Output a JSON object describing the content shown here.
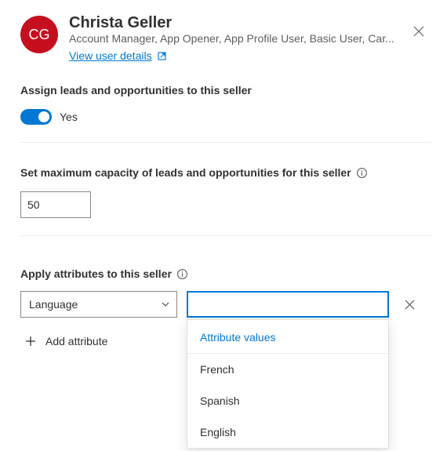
{
  "user": {
    "initials": "CG",
    "name": "Christa Geller",
    "roles": "Account Manager, App Opener, App Profile User, Basic User, Car...",
    "view_link": "View user details"
  },
  "assign": {
    "label": "Assign leads and opportunities to this seller",
    "toggle_text": "Yes"
  },
  "capacity": {
    "label": "Set maximum capacity of leads and opportunities for this seller",
    "value": "50"
  },
  "attributes": {
    "label": "Apply attributes to this seller",
    "selected_type": "Language",
    "value_input": "",
    "dropdown_header": "Attribute values",
    "options": [
      "French",
      "Spanish",
      "English"
    ],
    "add_label": "Add attribute"
  }
}
